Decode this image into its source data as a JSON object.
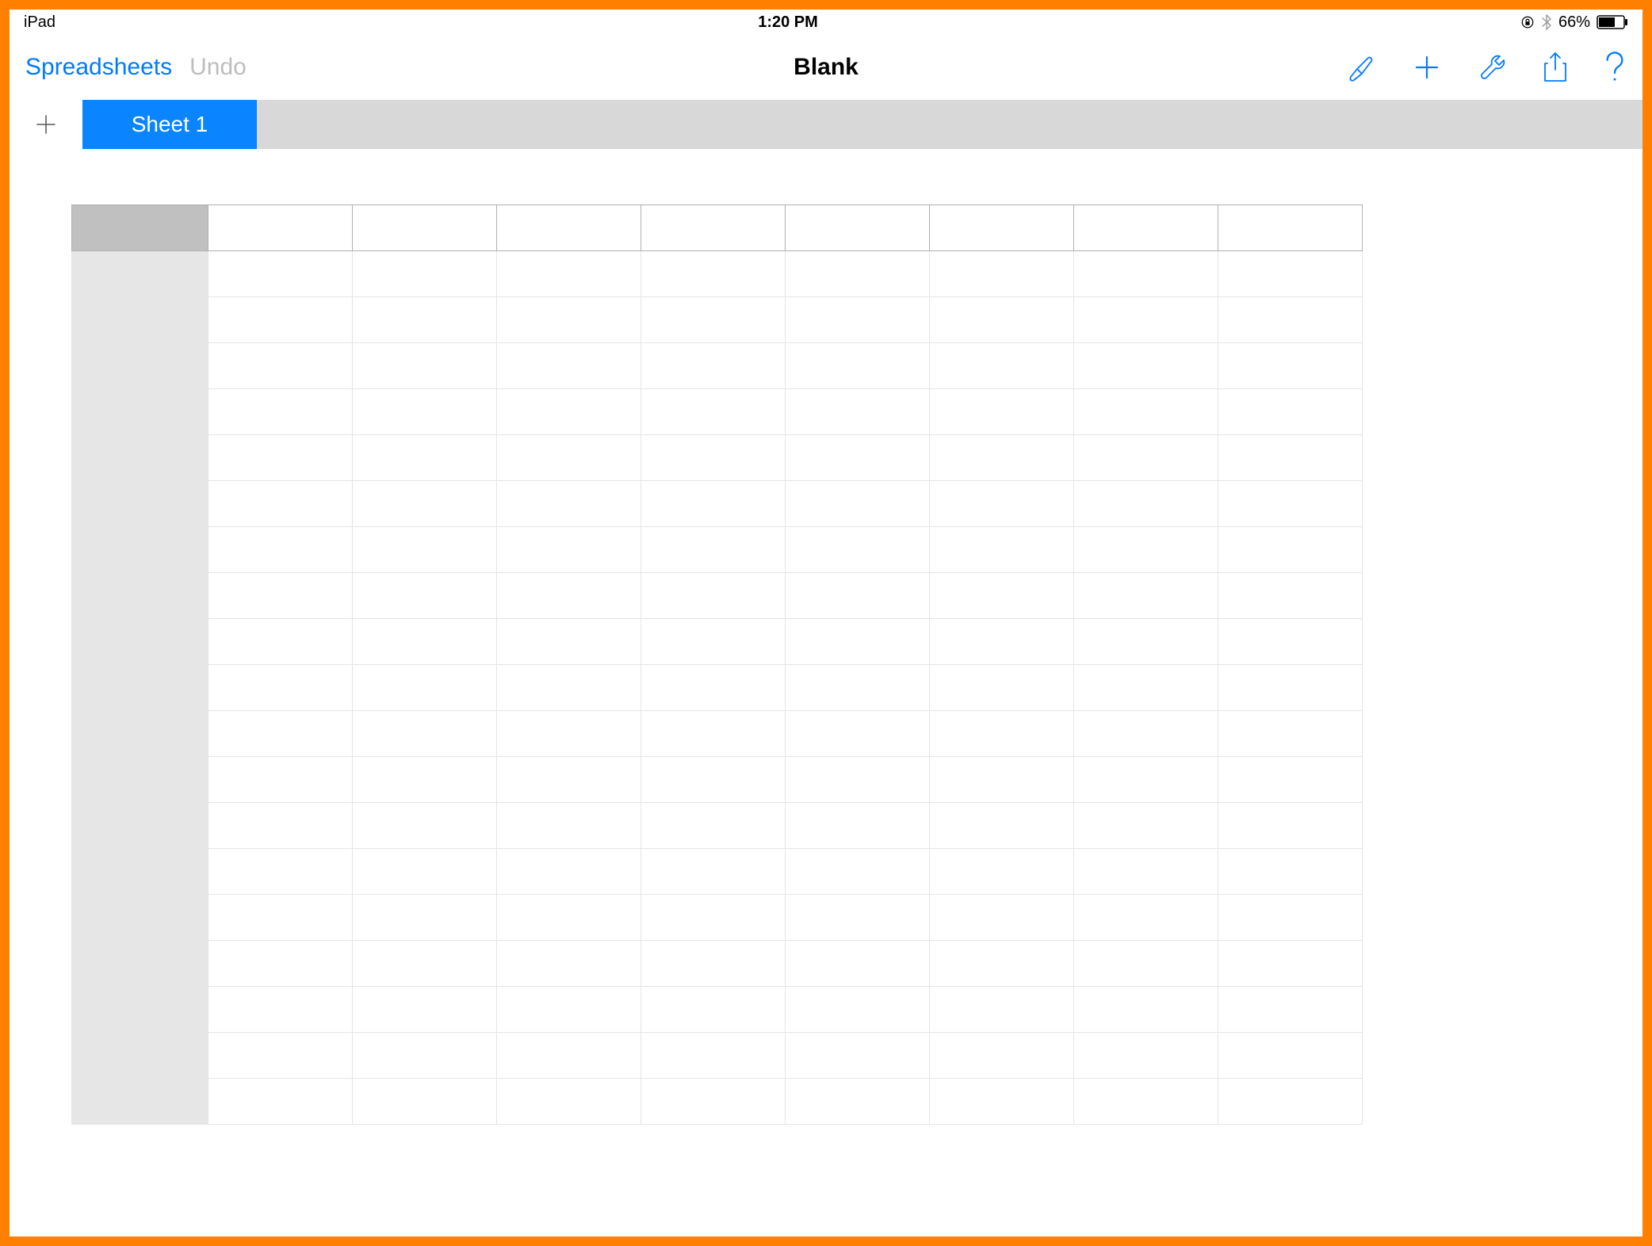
{
  "statusBar": {
    "device": "iPad",
    "time": "1:20 PM",
    "battery": "66%"
  },
  "toolbar": {
    "backLabel": "Spreadsheets",
    "undoLabel": "Undo",
    "documentTitle": "Blank"
  },
  "tabs": {
    "activeSheet": "Sheet 1"
  },
  "grid": {
    "columns": 8,
    "rows": 19
  },
  "colors": {
    "accent": "#007aff",
    "frameBorder": "#ff8000",
    "tabActive": "#0a84ff"
  }
}
